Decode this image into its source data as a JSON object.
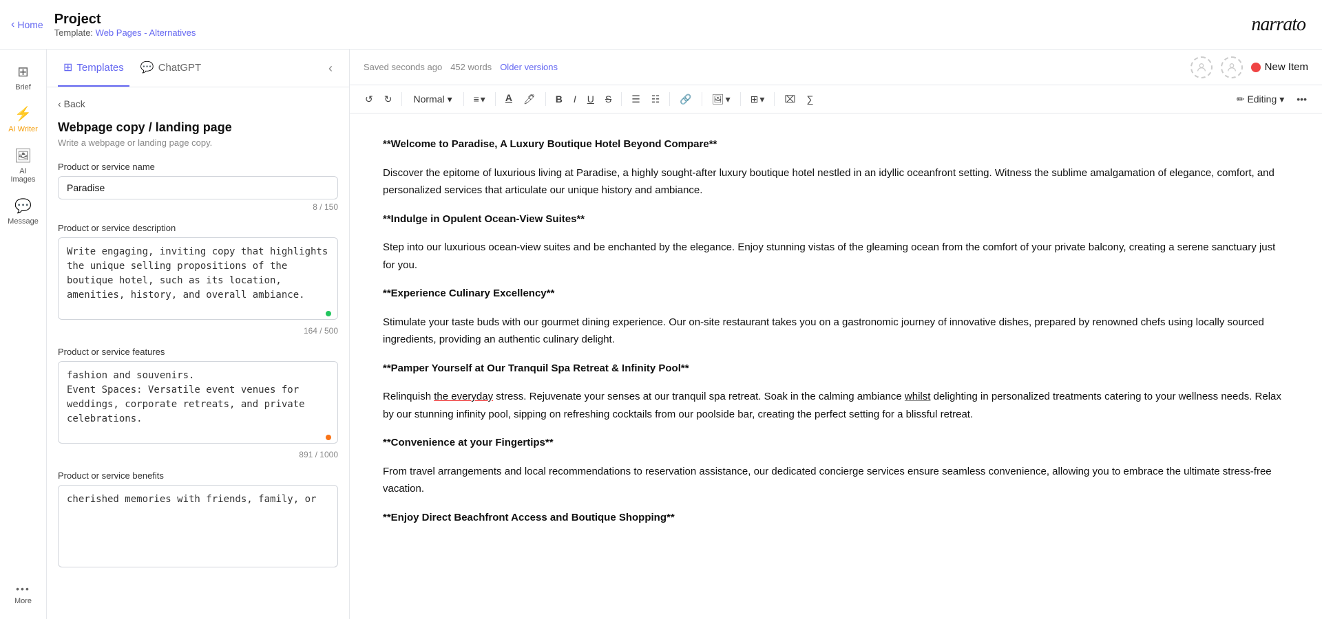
{
  "topbar": {
    "home_label": "Home",
    "project_title": "Project",
    "template_label": "Template: ",
    "template_link_text": "Web Pages - Alternatives",
    "logo": "narrato"
  },
  "sidebar": {
    "items": [
      {
        "id": "brief",
        "label": "Brief",
        "icon": "⊞",
        "active": false
      },
      {
        "id": "ai-writer",
        "label": "AI Writer",
        "icon": "⚡",
        "active": true
      },
      {
        "id": "ai-images",
        "label": "AI Images",
        "icon": "🖼",
        "active": false
      },
      {
        "id": "message",
        "label": "Message",
        "icon": "💬",
        "active": false
      },
      {
        "id": "more",
        "label": "More",
        "icon": "•••",
        "active": false
      }
    ]
  },
  "panel": {
    "tabs": [
      {
        "id": "templates",
        "label": "Templates",
        "icon": "⊞",
        "active": true
      },
      {
        "id": "chatgpt",
        "label": "ChatGPT",
        "icon": "💬",
        "active": false
      }
    ],
    "back_label": "Back",
    "section_title": "Webpage copy / landing page",
    "section_desc": "Write a webpage or landing page copy.",
    "fields": [
      {
        "id": "product-name",
        "label": "Product or service name",
        "type": "input",
        "value": "Paradise",
        "counter": "8 / 150"
      },
      {
        "id": "product-desc",
        "label": "Product or service description",
        "type": "textarea",
        "value": "Write engaging, inviting copy that highlights the unique selling propositions of the boutique hotel, such as its location, amenities, history, and overall ambiance.",
        "counter": "164 / 500",
        "dot": "green"
      },
      {
        "id": "product-features",
        "label": "Product or service features",
        "type": "textarea",
        "value": "fashion and souvenirs.\nEvent Spaces: Versatile event venues for weddings, corporate retreats, and private celebrations.",
        "counter": "891 / 1000",
        "dot": "orange"
      },
      {
        "id": "product-benefits",
        "label": "Product or service benefits",
        "type": "textarea",
        "value": "cherished memories with friends, family, or",
        "counter": ""
      }
    ]
  },
  "editor": {
    "saved_text": "Saved seconds ago",
    "word_count": "452 words",
    "older_versions": "Older versions",
    "new_item_label": "New Item",
    "toolbar": {
      "undo": "↺",
      "redo": "↻",
      "format_dropdown": "Normal",
      "align": "≡",
      "font_color": "A",
      "highlight": "✏",
      "bold": "B",
      "italic": "I",
      "underline": "U",
      "strikethrough": "S",
      "bullet_list": "☰",
      "ordered_list": "☷",
      "link": "🔗",
      "image": "🖼",
      "table": "⊞",
      "clear_format": "⌧",
      "formula": "∑",
      "editing": "Editing",
      "more_options": "•••"
    },
    "content": {
      "heading": "**Welcome to Paradise, A Luxury Boutique Hotel Beyond Compare**",
      "intro": "Discover the epitome of luxurious living at Paradise, a highly sought-after luxury boutique hotel nestled in an idyllic oceanfront setting. Witness the sublime amalgamation of elegance, comfort, and personalized services that articulate our unique history and ambiance.",
      "section1_heading": " **Indulge in Opulent Ocean-View Suites**",
      "section1_body": "Step into our luxurious ocean-view suites and be enchanted by the elegance. Enjoy stunning vistas of the gleaming ocean from the comfort of your private balcony, creating a serene sanctuary just for you.",
      "section2_heading": "**Experience Culinary Excellency**",
      "section2_body": "Stimulate your taste buds with our gourmet dining experience. Our on-site restaurant takes you on a gastronomic journey of innovative dishes, prepared by renowned chefs using locally sourced ingredients, providing an authentic culinary delight.",
      "section3_heading": "**Pamper Yourself at Our Tranquil Spa Retreat & Infinity Pool**",
      "section3_body": "Relinquish the everyday stress. Rejuvenate your senses at our tranquil spa retreat. Soak in the calming ambiance whilst delighting in personalized treatments catering to your wellness needs. Relax by our stunning infinity pool, sipping on refreshing cocktails from our poolside bar, creating the perfect setting for a blissful retreat.",
      "section4_heading": "**Convenience at your Fingertips**",
      "section4_body": "From travel arrangements and local recommendations to reservation assistance, our dedicated concierge services ensure seamless convenience, allowing you to embrace the ultimate stress-free vacation.",
      "section5_heading": "**Enjoy Direct Beachfront Access and Boutique Shopping**"
    }
  }
}
